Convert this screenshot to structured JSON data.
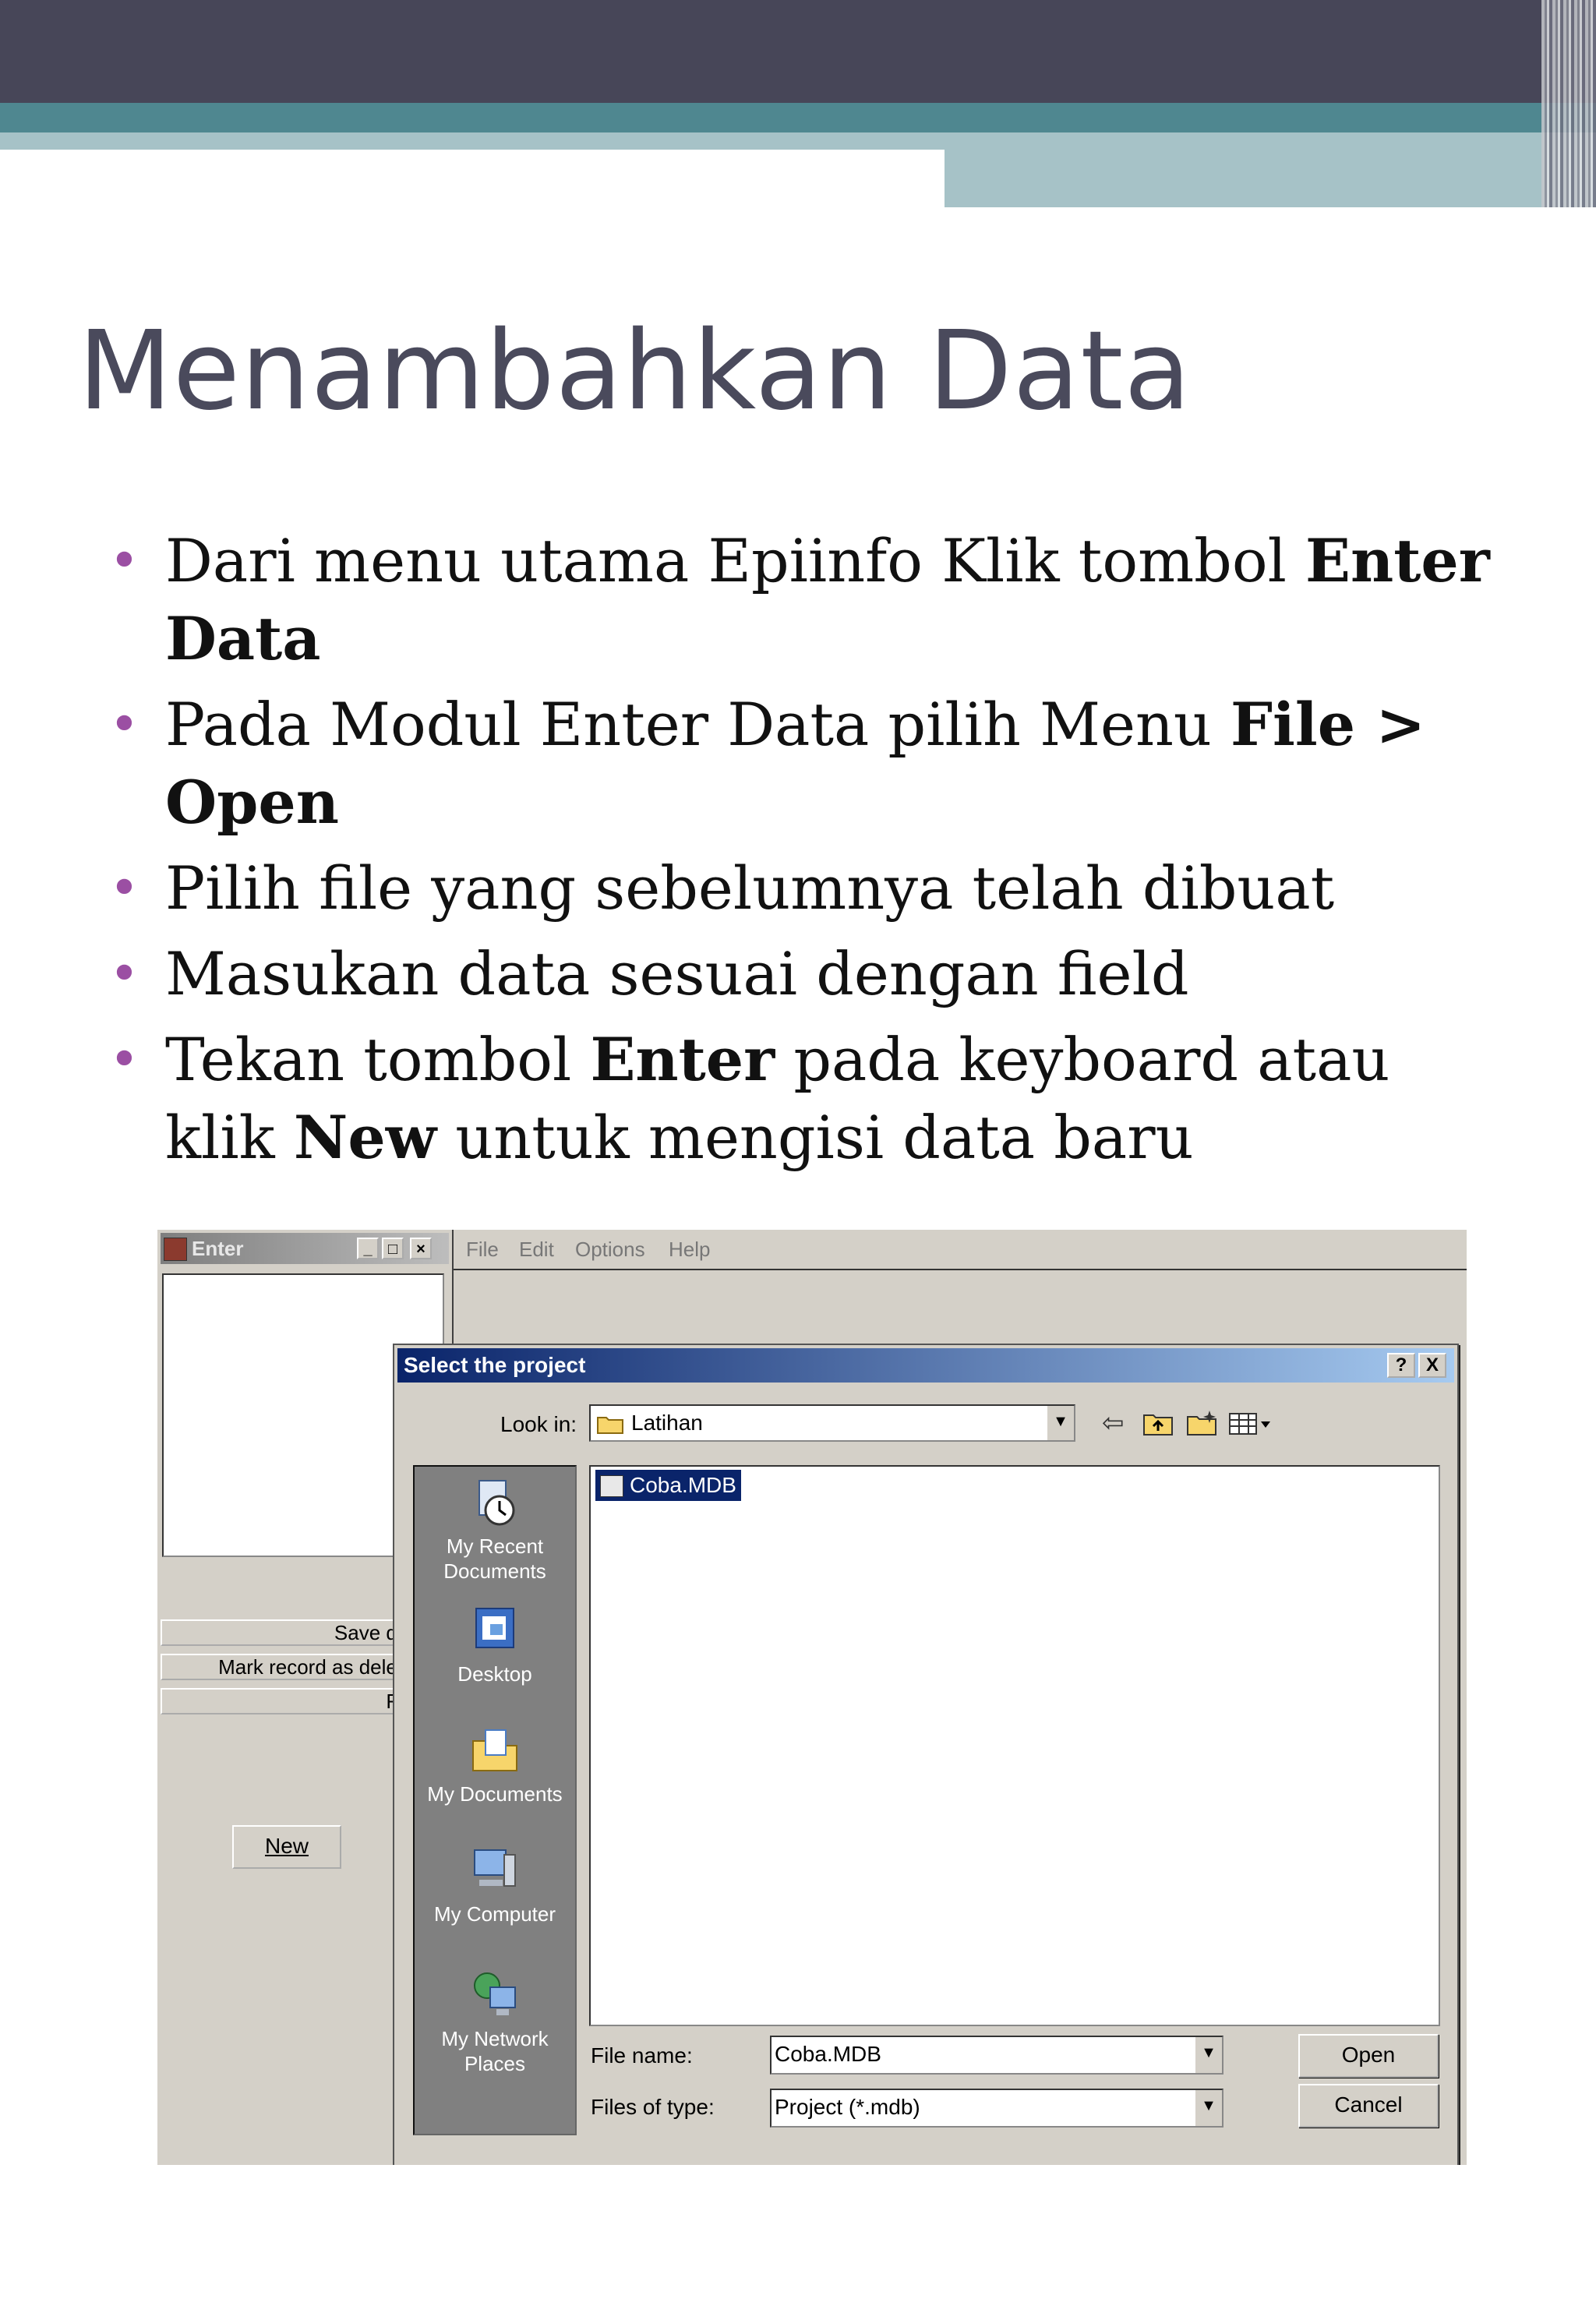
{
  "slide": {
    "title": "Menambahkan Data",
    "bullets": [
      {
        "parts": [
          {
            "text": "Dari menu utama Epiinfo Klik tombol "
          },
          {
            "text": "Enter Data",
            "bold": true
          }
        ]
      },
      {
        "parts": [
          {
            "text": "Pada Modul Enter Data pilih Menu "
          },
          {
            "text": "File > Open",
            "bold": true
          }
        ]
      },
      {
        "parts": [
          {
            "text": "Pilih file yang sebelumnya telah dibuat"
          }
        ]
      },
      {
        "parts": [
          {
            "text": "Masukan data sesuai dengan field"
          }
        ]
      },
      {
        "parts": [
          {
            "text": "Tekan tombol "
          },
          {
            "text": "Enter",
            "bold": true
          },
          {
            "text": " pada keyboard atau klik "
          },
          {
            "text": "New",
            "bold": true
          },
          {
            "text": " untuk mengisi data baru"
          }
        ]
      }
    ],
    "bullet_color": "#9b4fa3"
  },
  "enter_window": {
    "title": "Enter",
    "buttons": [
      "Save data",
      "Mark record as deleted",
      "Find"
    ],
    "new_label": "New"
  },
  "main_menu": [
    "File",
    "Edit",
    "Options",
    "Help"
  ],
  "dialog": {
    "title": "Select the project",
    "help_label": "?",
    "close_label": "X",
    "look_in_label": "Look in:",
    "look_in_value": "Latihan",
    "places": [
      "My Recent Documents",
      "Desktop",
      "My Documents",
      "My Computer",
      "My Network Places"
    ],
    "files": [
      "Coba.MDB"
    ],
    "file_name_label": "File name:",
    "file_name_value": "Coba.MDB",
    "file_type_label": "Files of type:",
    "file_type_value": "Project (*.mdb)",
    "open_label": "Open",
    "cancel_label": "Cancel"
  }
}
